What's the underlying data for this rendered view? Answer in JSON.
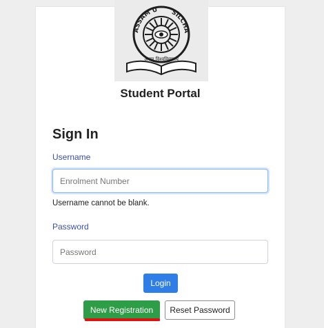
{
  "header": {
    "portal_title": "Student Portal",
    "logo_ring_text_left": "ASSAM U",
    "logo_ring_text_right": "SILCHAR",
    "logo_bottom_text": "असम विश्वविद्यालय"
  },
  "form": {
    "heading": "Sign In",
    "username": {
      "label": "Username",
      "placeholder": "Enrolment Number",
      "value": "",
      "error": "Username cannot be blank."
    },
    "password": {
      "label": "Password",
      "placeholder": "Password",
      "value": ""
    }
  },
  "buttons": {
    "login": "Login",
    "new_registration": "New Registration",
    "reset_password": "Reset Password"
  },
  "colors": {
    "primary": "#2f7ee8",
    "success": "#2e9d47",
    "label": "#3a4fa8",
    "annotation_underline": "#e01010"
  }
}
